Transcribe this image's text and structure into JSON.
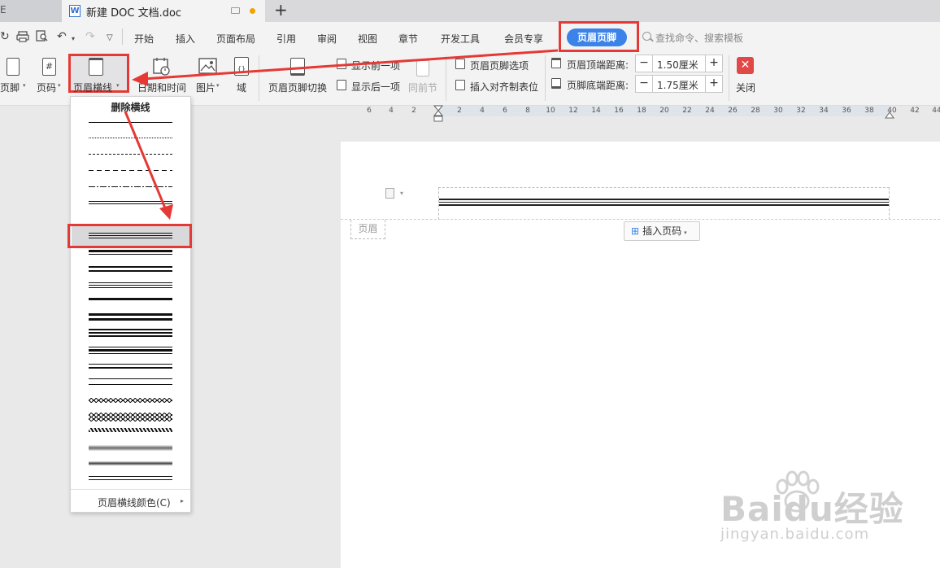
{
  "titlebar": {
    "prev_tab_label": "E",
    "active_tab_title": "新建 DOC 文档.doc",
    "doc_icon_letter": "W",
    "new_tab": "+"
  },
  "menu": {
    "items": [
      "开始",
      "插入",
      "页面布局",
      "引用",
      "审阅",
      "视图",
      "章节",
      "开发工具",
      "会员专享"
    ],
    "active_tab": "页眉页脚",
    "search_placeholder": "查找命令、搜索模板"
  },
  "ribbon": {
    "footer": "页脚",
    "page_number": "页码",
    "header_line": "页眉横线",
    "date_time": "日期和时间",
    "picture": "图片",
    "field": "域",
    "hf_switch": "页眉页脚切换",
    "show_prev": "显示前一项",
    "show_next": "显示后一项",
    "same_as_prev": "同前节",
    "hf_options": "页眉页脚选项",
    "insert_align_tab": "插入对齐制表位",
    "header_top_label": "页眉顶端距离:",
    "header_top_value": "1.50厘米",
    "footer_bottom_label": "页脚底端距离:",
    "footer_bottom_value": "1.75厘米",
    "close": "关闭",
    "minus": "−",
    "plus": "+"
  },
  "ruler": {
    "ticks": [
      "6",
      "4",
      "2",
      "2",
      "4",
      "6",
      "8",
      "10",
      "12",
      "14",
      "16",
      "18",
      "20",
      "22",
      "24",
      "26",
      "28",
      "30",
      "32",
      "34",
      "36",
      "38",
      "40",
      "42",
      "44"
    ]
  },
  "dropdown": {
    "title": "删除横线",
    "footer": "页眉横线颜色(C)",
    "line_styles": [
      "single-thin",
      "dotted",
      "dashed-fine",
      "dashed",
      "dash-dot",
      "double-thin",
      "triple",
      "thick-thin",
      "double-medium",
      "triple-thin",
      "thick",
      "thick-double",
      "thick-triple",
      "thick-thin-mix",
      "thin-thick",
      "double-spaced",
      "wavy",
      "double-wavy",
      "hatched",
      "gradient-bar",
      "gradient-thin",
      "thin-spaced"
    ]
  },
  "document": {
    "header_tag": "页眉",
    "insert_page_number": "插入页码"
  },
  "watermark": {
    "brand": "Baidu经验",
    "url": "jingyan.baidu.com"
  },
  "colors": {
    "highlight_red": "#e53935",
    "accent_blue": "#3b83e8",
    "close_red": "#e14848"
  }
}
